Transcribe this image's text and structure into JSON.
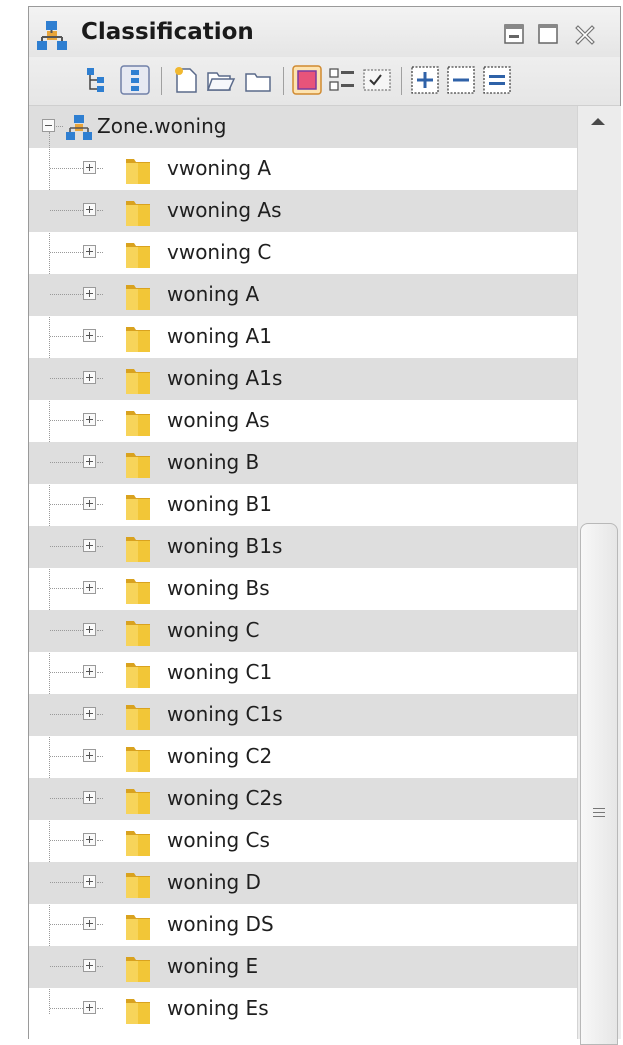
{
  "panel": {
    "title": "Classification",
    "icons": {
      "title": "classification-tree-icon",
      "minimize": "minimize-icon",
      "maximize": "maximize-icon",
      "close": "close-icon"
    }
  },
  "toolbar": {
    "buttons": [
      "hierarchy-view-icon",
      "flat-view-icon",
      "new-document-icon",
      "open-folder-icon",
      "folder-icon",
      "color-view-icon",
      "list-view-icon",
      "checkbox-view-icon",
      "expand-all-icon",
      "collapse-all-icon",
      "equal-icon"
    ]
  },
  "tree": {
    "root": {
      "label": "Zone.woning",
      "expanded": true
    },
    "items": [
      {
        "label": "vwoning A"
      },
      {
        "label": "vwoning As"
      },
      {
        "label": "vwoning C"
      },
      {
        "label": "woning A"
      },
      {
        "label": "woning A1"
      },
      {
        "label": "woning A1s"
      },
      {
        "label": "woning As"
      },
      {
        "label": "woning B"
      },
      {
        "label": "woning B1"
      },
      {
        "label": "woning B1s"
      },
      {
        "label": "woning Bs"
      },
      {
        "label": "woning C"
      },
      {
        "label": "woning C1"
      },
      {
        "label": "woning C1s"
      },
      {
        "label": "woning C2"
      },
      {
        "label": "woning C2s"
      },
      {
        "label": "woning Cs"
      },
      {
        "label": "woning D"
      },
      {
        "label": "woning DS"
      },
      {
        "label": "woning E"
      },
      {
        "label": "woning Es"
      }
    ]
  },
  "colors": {
    "alt_row": "#dedede",
    "folder": "#f2c637",
    "selected_toggle": "#e8547a"
  }
}
